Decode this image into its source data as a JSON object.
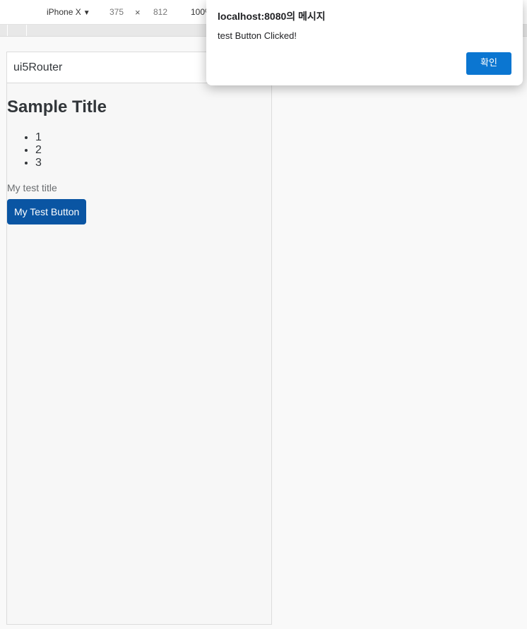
{
  "devtools": {
    "device_name": "iPhone X",
    "caret": "▼",
    "width": "375",
    "times": "×",
    "height": "812",
    "zoom": "100%"
  },
  "app": {
    "header_title": "ui5Router",
    "page_title": "Sample Title",
    "list_items": [
      "1",
      "2",
      "3"
    ],
    "subtitle": "My test title",
    "button_label": "My Test Button"
  },
  "dialog": {
    "title": "localhost:8080의 메시지",
    "message": "test Button Clicked!",
    "ok_label": "확인"
  },
  "colors": {
    "button_bg": "#0a55a3",
    "dialog_ok_bg": "#0b76d1"
  }
}
